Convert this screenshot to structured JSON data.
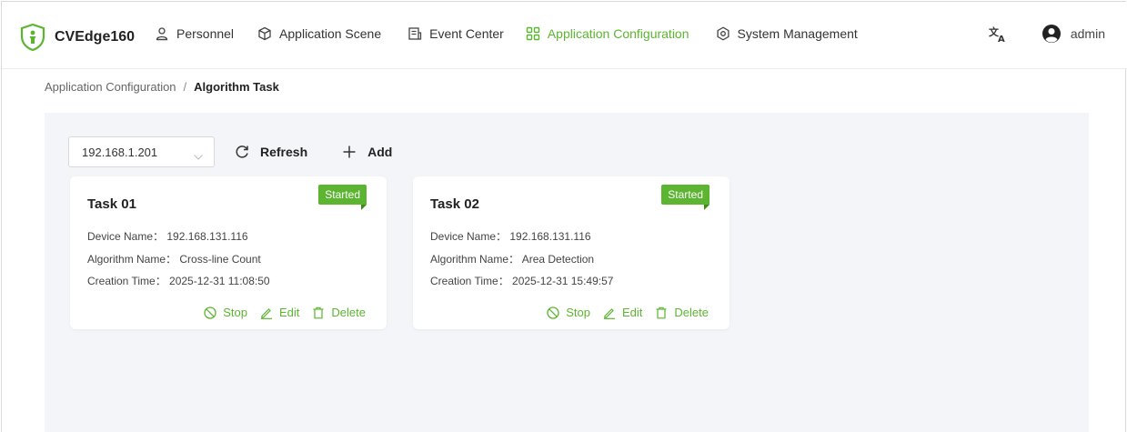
{
  "app": {
    "name": "CVEdge160",
    "accent_color": "#5cb531"
  },
  "nav": {
    "items": [
      {
        "label": "Personnel",
        "icon": "person-icon"
      },
      {
        "label": "Application Scene",
        "icon": "cube-icon"
      },
      {
        "label": "Event Center",
        "icon": "document-icon"
      },
      {
        "label": "Application Configuration",
        "icon": "grid-icon",
        "active": true
      },
      {
        "label": "System Management",
        "icon": "gear-icon"
      }
    ],
    "user": "admin"
  },
  "breadcrumb": {
    "parent": "Application Configuration",
    "separator": "/",
    "current": "Algorithm Task"
  },
  "toolbar": {
    "device_select_value": "192.168.1.201",
    "refresh_label": "Refresh",
    "add_label": "Add"
  },
  "tasks": [
    {
      "title": "Task 01",
      "status": "Started",
      "device_line": "Device Name： 192.168.131.116",
      "algorithm_line": "Algorithm Name： Cross-line Count",
      "time_line": "Creation Time： 2025-12-31 11:08:50",
      "stop_label": "Stop",
      "edit_label": "Edit",
      "delete_label": "Delete"
    },
    {
      "title": "Task 02",
      "status": "Started",
      "device_line": "Device Name： 192.168.131.116",
      "algorithm_line": "Algorithm Name： Area Detection",
      "time_line": "Creation Time： 2025-12-31 15:49:57",
      "stop_label": "Stop",
      "edit_label": "Edit",
      "delete_label": "Delete"
    }
  ]
}
